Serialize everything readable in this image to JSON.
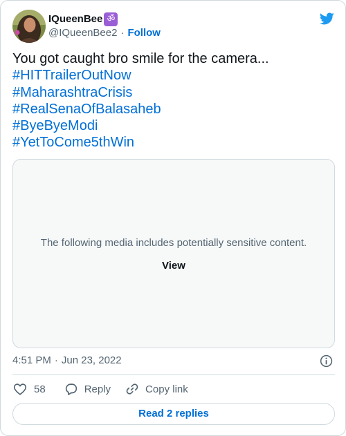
{
  "author": {
    "display_name": "IQueenBee",
    "badge_icon": "om-symbol-icon",
    "badge_glyph": "ॐ",
    "badge_color": "#9a5fd6",
    "handle": "@IQueenBee2",
    "separator": "·",
    "follow_label": "Follow"
  },
  "brand": {
    "logo_icon": "twitter-bird-icon",
    "color": "#1d9bf0"
  },
  "tweet": {
    "text": "You got caught bro smile for the camera...",
    "hashtags": [
      "#HITTrailerOutNow",
      "#MaharashtraCrisis",
      "#RealSenaOfBalasaheb",
      "#ByeByeModi",
      "#YetToCome5thWin"
    ]
  },
  "media": {
    "warning": "The following media includes potentially sensitive content.",
    "view_label": "View"
  },
  "meta": {
    "time": "4:51 PM",
    "separator": "·",
    "date": "Jun 23, 2022",
    "info_icon": "info-icon"
  },
  "actions": {
    "like_icon": "heart-icon",
    "like_count": "58",
    "reply_icon": "reply-bubble-icon",
    "reply_label": "Reply",
    "copy_icon": "link-icon",
    "copy_label": "Copy link"
  },
  "footer": {
    "read_replies_label": "Read 2 replies"
  },
  "colors": {
    "link": "#006fd6",
    "secondary_text": "#536471",
    "border": "#cfd9de"
  }
}
